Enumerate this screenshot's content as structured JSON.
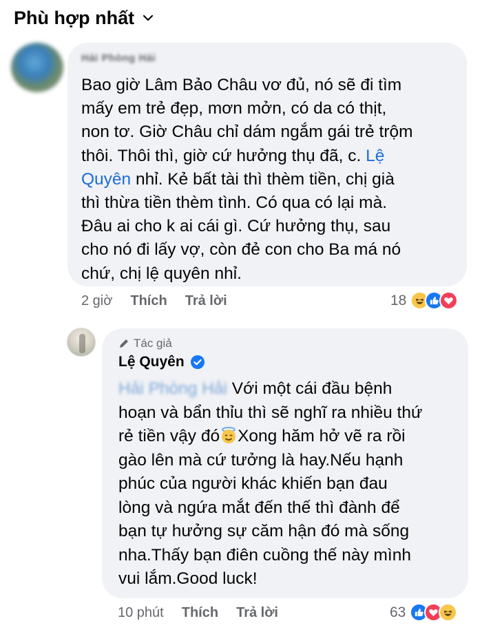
{
  "sort": {
    "label": "Phù hợp nhất"
  },
  "comment1": {
    "author": "Hải Phòng Hải",
    "lines": [
      [
        "Bao giờ Lâm Bảo Châu vơ đủ, nó sẽ đi tìm"
      ],
      [
        "mấy em trẻ đẹp, mơn mởn, có da có thịt,"
      ],
      [
        "non tơ. Giờ Châu chỉ dám  ngắm gái trẻ trộm"
      ],
      [
        "thôi. Thôi thì, giờ cứ hưởng thụ đã, c. "
      ],
      [
        "Quyên",
        " nhỉ. Kẻ bất tài thì thèm tiền, chị già"
      ],
      [
        "thì thừa tiền thèm tình. Có qua có lại mà."
      ],
      [
        "Đâu ai cho k ai cái gì. Cứ hưởng thụ, sau"
      ],
      [
        "cho nó đi lấy vợ, còn đẻ con cho Ba má nó"
      ],
      [
        "chứ, chị lệ quyên nhỉ."
      ]
    ],
    "line4_link": "Lệ",
    "time": "2 giờ",
    "like_label": "Thích",
    "reply_label": "Trả lời",
    "reaction_count": "18"
  },
  "comment2": {
    "author_badge": "Tác giả",
    "author": "Lệ Quyên",
    "mention": "Hải Phòng Hải",
    "lines": [
      " Với một cái đầu bệnh",
      "hoạn và bẩn thỉu thì sẽ nghĩ ra nhiều thứ",
      "rẻ tiền vậy đó",
      "Xong hăm hở vẽ ra rồi",
      "gào lên mà cứ tưởng là hay.Nếu hạnh",
      "phúc của người khác khiến bạn đau",
      "lòng và ngứa mắt đến thế thì đành để",
      "bạn tự hưởng sự căm hận đó mà sống",
      "nha.Thấy bạn điên cuồng thế này mình",
      "vui lắm.Good luck!"
    ],
    "time": "10 phút",
    "like_label": "Thích",
    "reply_label": "Trả lời",
    "reaction_count": "63"
  },
  "colors": {
    "bubble": "#f0f2f5",
    "link": "#1d6cd6",
    "meta": "#65676b",
    "verified": "#1877f2"
  },
  "icons": [
    "chevron-down-icon",
    "pencil-icon",
    "verified-badge-icon",
    "halo-smile-emoji",
    "haha-reaction-icon",
    "like-reaction-icon",
    "love-reaction-icon"
  ]
}
